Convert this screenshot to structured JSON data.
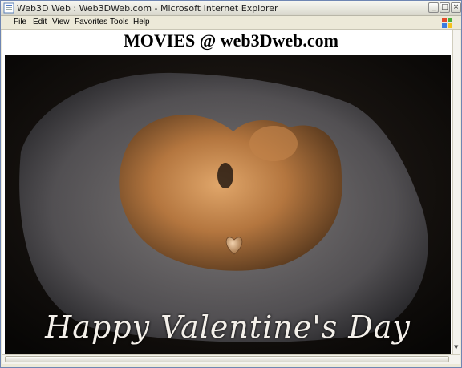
{
  "window": {
    "title": "Web3D Web : Web3DWeb.com - Microsoft Internet Explorer",
    "buttons": {
      "minimize": "_",
      "maximize": "□",
      "close": "×"
    }
  },
  "menu": {
    "items": [
      "File",
      "Edit",
      "View",
      "Favorites",
      "Tools",
      "Help"
    ]
  },
  "page": {
    "heading": "MOVIES @ web3Dweb.com",
    "video_caption": "Happy Valentine's Day"
  },
  "icons": {
    "app": "ie-page-icon",
    "brand": "windows-logo-icon"
  },
  "colors": {
    "titlebar": "#e6e5dc",
    "frame": "#ece9d8",
    "video_bg": "#0a0806",
    "caption": "#f4f0ea"
  }
}
